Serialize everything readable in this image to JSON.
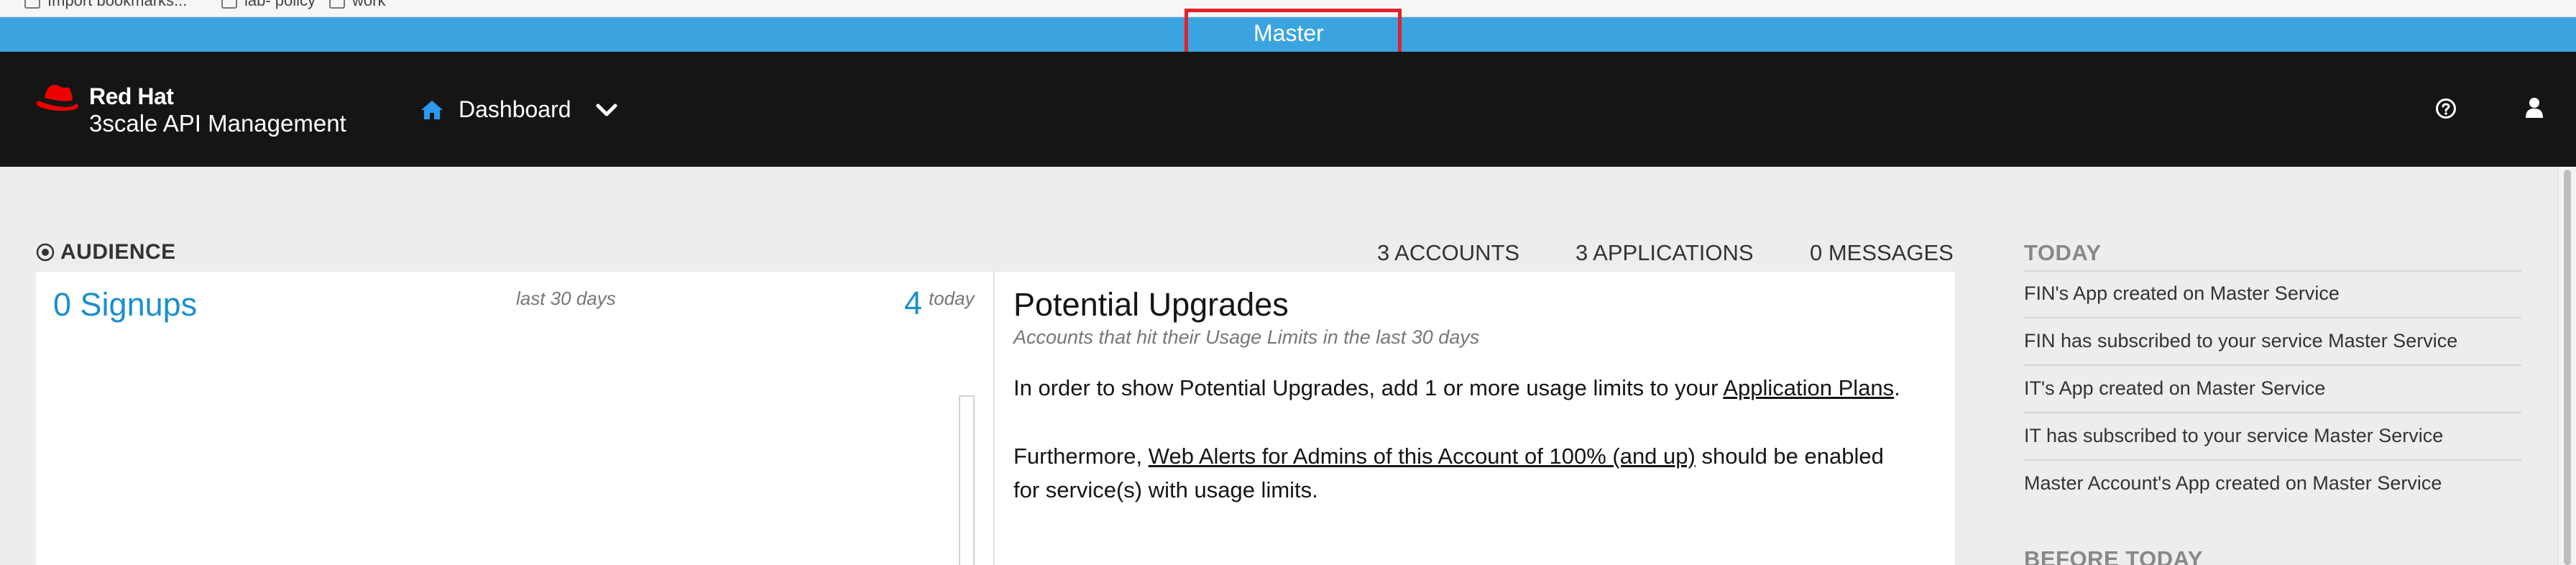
{
  "bookmarks": {
    "items": [
      {
        "label": "Import bookmarks..."
      },
      {
        "label": "lab- policy"
      },
      {
        "label": "work"
      }
    ]
  },
  "master_bar": {
    "label": "Master"
  },
  "header": {
    "brand": {
      "company": "Red Hat",
      "product": "3scale API Management"
    },
    "nav": {
      "label": "Dashboard",
      "icon": "home-icon",
      "dropdown_icon": "chevron-down-icon"
    },
    "help_icon": "help-circle-icon",
    "user_icon": "user-icon"
  },
  "audience": {
    "title": "AUDIENCE",
    "stats": {
      "accounts": "3 ACCOUNTS",
      "applications": "3 APPLICATIONS",
      "messages": "0 MESSAGES"
    }
  },
  "signups": {
    "count_label": "0 Signups",
    "period": "last 30 days",
    "today_count": "4",
    "today_label": "today"
  },
  "upgrades": {
    "title": "Potential Upgrades",
    "subtitle": "Accounts that hit their Usage Limits in the last 30 days",
    "p1_prefix": "In order to show Potential Upgrades, add 1 or more usage limits to your ",
    "p1_link": "Application Plans",
    "p1_suffix": ".",
    "p2_prefix": "Furthermore, ",
    "p2_link": "Web Alerts for Admins of this Account of 100% (and up)",
    "p2_suffix": " should be enabled",
    "p2_line2": "for service(s) with usage limits."
  },
  "today": {
    "title": "TODAY",
    "events": [
      "FIN's App created on Master Service",
      "FIN has subscribed to your service Master Service",
      "IT's App created on Master Service",
      "IT has subscribed to your service Master Service",
      "Master Account's App created on Master Service"
    ]
  },
  "before_today": {
    "title": "BEFORE TODAY"
  },
  "colors": {
    "master_bar": "#3ba4e0",
    "header_bg": "#151515",
    "accent_link": "#1a8fcf",
    "highlight_box": "#e3202a",
    "redhat_red": "#ee0000"
  }
}
